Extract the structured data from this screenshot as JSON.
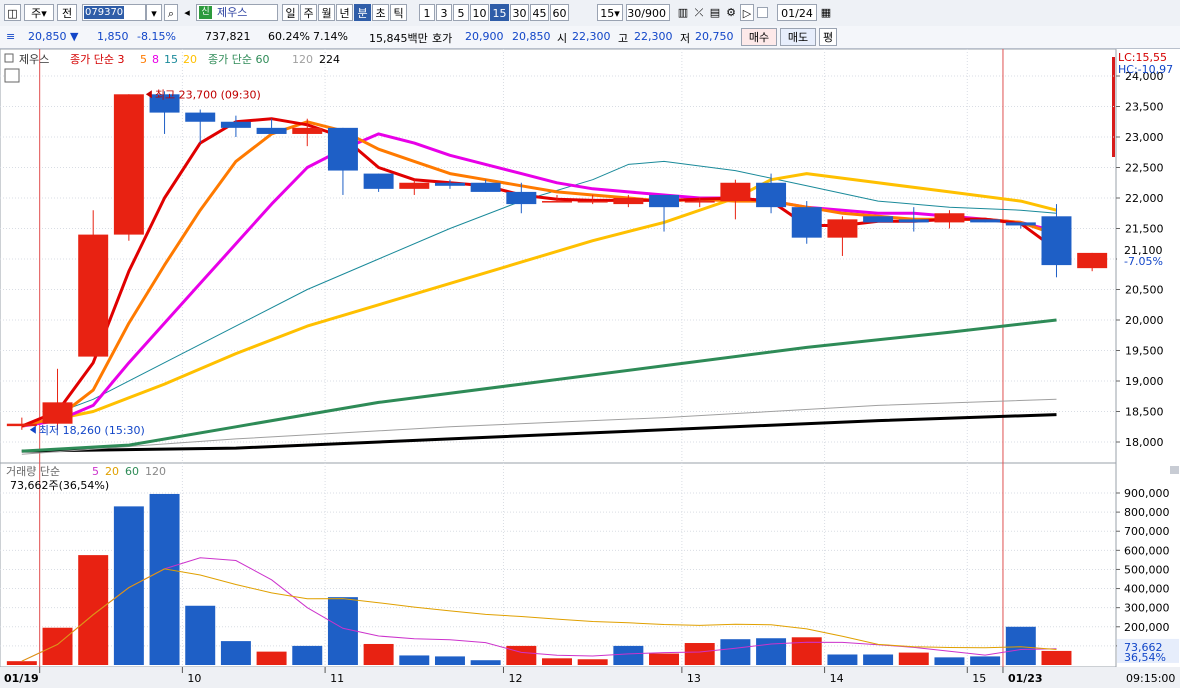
{
  "toolbar": {
    "btn_stock": "주",
    "btn_prev": "전",
    "stock_code": "079370",
    "stock_name": "제우스",
    "badge": "신",
    "periods": [
      "일",
      "주",
      "월",
      "년",
      "분",
      "초",
      "틱"
    ],
    "active_period": "분",
    "intervals": [
      "1",
      "3",
      "5",
      "10",
      "15",
      "30",
      "45",
      "60"
    ],
    "active_interval": "15",
    "interval_select": "15",
    "count": "30/900",
    "date": "01/24"
  },
  "quote": {
    "price": "20,850",
    "change": "1,850",
    "change_pct": "-8.15%",
    "volume": "737,821",
    "volume_ratio": "60.24%",
    "turnover_pct": "7.14%",
    "amount": "15,845백만",
    "ask_label": "호가",
    "ask": "20,900",
    "bid": "20,850",
    "open_label": "시",
    "open": "22,300",
    "high_label": "고",
    "high": "22,300",
    "low_label": "저",
    "low": "20,750",
    "buy_button": "매수",
    "sell_button": "매도",
    "eval_button": "평"
  },
  "price_panel": {
    "legend_name": "제우스",
    "legend_ma_a": "종가 단순 3",
    "legend_ma_a_periods": [
      "5",
      "8",
      "15",
      "20"
    ],
    "legend_ma_b": "종가 단순 60",
    "legend_ma_b_periods": [
      "120",
      "224"
    ],
    "lc": "LC:15,55",
    "hc": "HC:-10,97",
    "high_note": "최고 23,700 (09:30)",
    "low_note": "최저 18,260 (15:30)",
    "last_price": "21,100",
    "last_pct": "-7.05%",
    "colors": {
      "up": "#e82212",
      "down": "#1e5fc6",
      "ma3": "#e00000",
      "ma5": "#ff7a00",
      "ma8": "#e800e8",
      "ma15": "#1a8a9a",
      "ma20": "#ffc000",
      "ma60": "#2e8b57",
      "ma120": "#a0a0a0",
      "ma224": "#000000"
    }
  },
  "volume_panel": {
    "legend": "거래량 단순",
    "legend_periods": [
      "5",
      "20",
      "60",
      "120"
    ],
    "current": "73,662주(36,54%)",
    "last_value": "73,662",
    "last_pct": "36,54%"
  },
  "x_axis": {
    "labels": [
      "01/19",
      "10",
      "11",
      "12",
      "13",
      "14",
      "15",
      "01/23"
    ],
    "time": "09:15:00"
  },
  "chart_data": {
    "type": "candlestick",
    "price_axis_ticks": [
      18000,
      18500,
      19000,
      19500,
      20000,
      20500,
      21000,
      21500,
      22000,
      22500,
      23000,
      23500,
      24000
    ],
    "volume_axis_ticks": [
      100000,
      200000,
      300000,
      400000,
      500000,
      600000,
      700000,
      800000,
      900000
    ],
    "candles": [
      {
        "o": 18260,
        "h": 18400,
        "l": 18200,
        "c": 18300
      },
      {
        "o": 18300,
        "h": 19200,
        "l": 18200,
        "c": 18650
      },
      {
        "o": 19400,
        "h": 21800,
        "l": 19400,
        "c": 21400
      },
      {
        "o": 21400,
        "h": 23700,
        "l": 21300,
        "c": 23700
      },
      {
        "o": 23700,
        "h": 23750,
        "l": 23050,
        "c": 23400
      },
      {
        "o": 23400,
        "h": 23450,
        "l": 22900,
        "c": 23250
      },
      {
        "o": 23250,
        "h": 23350,
        "l": 23000,
        "c": 23150
      },
      {
        "o": 23150,
        "h": 23300,
        "l": 23050,
        "c": 23050
      },
      {
        "o": 23050,
        "h": 23300,
        "l": 22850,
        "c": 23150
      },
      {
        "o": 23150,
        "h": 23150,
        "l": 22050,
        "c": 22450
      },
      {
        "o": 22400,
        "h": 22400,
        "l": 22100,
        "c": 22150
      },
      {
        "o": 22150,
        "h": 22300,
        "l": 22050,
        "c": 22250
      },
      {
        "o": 22250,
        "h": 22300,
        "l": 22150,
        "c": 22200
      },
      {
        "o": 22250,
        "h": 22300,
        "l": 22100,
        "c": 22100
      },
      {
        "o": 22100,
        "h": 22250,
        "l": 21750,
        "c": 21900
      },
      {
        "o": 21950,
        "h": 22050,
        "l": 21950,
        "c": 21950
      },
      {
        "o": 21950,
        "h": 22050,
        "l": 21900,
        "c": 21950
      },
      {
        "o": 21900,
        "h": 22050,
        "l": 21850,
        "c": 22000
      },
      {
        "o": 22050,
        "h": 22050,
        "l": 21450,
        "c": 21850
      },
      {
        "o": 21950,
        "h": 22000,
        "l": 21850,
        "c": 21950
      },
      {
        "o": 21950,
        "h": 22300,
        "l": 21650,
        "c": 22250
      },
      {
        "o": 22250,
        "h": 22400,
        "l": 21750,
        "c": 21850
      },
      {
        "o": 21850,
        "h": 21950,
        "l": 21250,
        "c": 21350
      },
      {
        "o": 21350,
        "h": 21700,
        "l": 21050,
        "c": 21650
      },
      {
        "o": 21700,
        "h": 21700,
        "l": 21600,
        "c": 21600
      },
      {
        "o": 21650,
        "h": 21850,
        "l": 21450,
        "c": 21600
      },
      {
        "o": 21600,
        "h": 21800,
        "l": 21500,
        "c": 21750
      },
      {
        "o": 21650,
        "h": 21650,
        "l": 21600,
        "c": 21600
      },
      {
        "o": 21600,
        "h": 21600,
        "l": 21500,
        "c": 21550
      },
      {
        "o": 21700,
        "h": 21900,
        "l": 20700,
        "c": 20900
      },
      {
        "o": 20850,
        "h": 21100,
        "l": 20800,
        "c": 21100
      }
    ],
    "volumes": [
      20000,
      195000,
      575000,
      830000,
      895000,
      310000,
      125000,
      70000,
      100000,
      355000,
      110000,
      50000,
      45000,
      25000,
      100000,
      35000,
      30000,
      100000,
      60000,
      115000,
      135000,
      140000,
      145000,
      55000,
      55000,
      65000,
      40000,
      45000,
      200000,
      73662
    ],
    "ma_series": {
      "ma3": [
        [
          0,
          18260
        ],
        [
          1,
          18500
        ],
        [
          2,
          19300
        ],
        [
          3,
          20800
        ],
        [
          4,
          22000
        ],
        [
          5,
          22900
        ],
        [
          6,
          23250
        ],
        [
          7,
          23300
        ],
        [
          8,
          23200
        ],
        [
          9,
          23000
        ],
        [
          10,
          22500
        ],
        [
          11,
          22300
        ],
        [
          12,
          22250
        ],
        [
          13,
          22200
        ],
        [
          14,
          22050
        ],
        [
          15,
          21980
        ],
        [
          16,
          21960
        ],
        [
          17,
          21960
        ],
        [
          18,
          21960
        ],
        [
          19,
          21980
        ],
        [
          20,
          22000
        ],
        [
          21,
          21950
        ],
        [
          22,
          21550
        ],
        [
          23,
          21550
        ],
        [
          24,
          21620
        ],
        [
          25,
          21620
        ],
        [
          26,
          21650
        ],
        [
          27,
          21650
        ],
        [
          28,
          21580
        ],
        [
          29,
          21150
        ]
      ],
      "ma5": [
        [
          0,
          18260
        ],
        [
          1,
          18400
        ],
        [
          2,
          18850
        ],
        [
          3,
          19950
        ],
        [
          4,
          20900
        ],
        [
          5,
          21800
        ],
        [
          6,
          22600
        ],
        [
          7,
          23050
        ],
        [
          8,
          23250
        ],
        [
          9,
          23100
        ],
        [
          10,
          22800
        ],
        [
          11,
          22600
        ],
        [
          12,
          22400
        ],
        [
          13,
          22300
        ],
        [
          14,
          22200
        ],
        [
          15,
          22100
        ],
        [
          16,
          22050
        ],
        [
          17,
          22000
        ],
        [
          18,
          21950
        ],
        [
          19,
          21980
        ],
        [
          20,
          21950
        ],
        [
          21,
          21950
        ],
        [
          22,
          21850
        ],
        [
          23,
          21750
        ],
        [
          24,
          21700
        ],
        [
          25,
          21650
        ],
        [
          26,
          21650
        ],
        [
          27,
          21650
        ],
        [
          28,
          21600
        ],
        [
          29,
          21400
        ]
      ],
      "ma8": [
        [
          0,
          18260
        ],
        [
          1,
          18350
        ],
        [
          2,
          18600
        ],
        [
          3,
          19300
        ],
        [
          4,
          19950
        ],
        [
          5,
          20600
        ],
        [
          6,
          21250
        ],
        [
          7,
          21900
        ],
        [
          8,
          22500
        ],
        [
          9,
          22800
        ],
        [
          10,
          23050
        ],
        [
          11,
          22900
        ],
        [
          12,
          22700
        ],
        [
          13,
          22550
        ],
        [
          14,
          22400
        ],
        [
          15,
          22250
        ],
        [
          16,
          22150
        ],
        [
          17,
          22100
        ],
        [
          18,
          22050
        ],
        [
          19,
          22000
        ],
        [
          20,
          22000
        ],
        [
          21,
          21950
        ],
        [
          22,
          21850
        ],
        [
          23,
          21800
        ],
        [
          24,
          21750
        ],
        [
          25,
          21750
        ],
        [
          26,
          21700
        ],
        [
          27,
          21650
        ],
        [
          28,
          21600
        ],
        [
          29,
          21450
        ]
      ],
      "ma15": [
        [
          0,
          18260
        ],
        [
          2,
          18700
        ],
        [
          4,
          19300
        ],
        [
          6,
          19900
        ],
        [
          8,
          20500
        ],
        [
          10,
          21000
        ],
        [
          12,
          21500
        ],
        [
          14,
          21950
        ],
        [
          16,
          22300
        ],
        [
          17,
          22550
        ],
        [
          18,
          22600
        ],
        [
          20,
          22450
        ],
        [
          22,
          22200
        ],
        [
          24,
          21950
        ],
        [
          26,
          21850
        ],
        [
          28,
          21800
        ],
        [
          29,
          21750
        ]
      ],
      "ma20": [
        [
          0,
          18260
        ],
        [
          2,
          18500
        ],
        [
          4,
          18950
        ],
        [
          6,
          19450
        ],
        [
          8,
          19900
        ],
        [
          10,
          20250
        ],
        [
          12,
          20600
        ],
        [
          14,
          20950
        ],
        [
          16,
          21300
        ],
        [
          18,
          21600
        ],
        [
          20,
          22000
        ],
        [
          21,
          22300
        ],
        [
          22,
          22400
        ],
        [
          24,
          22250
        ],
        [
          26,
          22100
        ],
        [
          28,
          21950
        ],
        [
          29,
          21800
        ]
      ],
      "ma60": [
        [
          0,
          17850
        ],
        [
          3,
          17950
        ],
        [
          6,
          18250
        ],
        [
          10,
          18650
        ],
        [
          14,
          18950
        ],
        [
          18,
          19250
        ],
        [
          22,
          19550
        ],
        [
          26,
          19800
        ],
        [
          29,
          20000
        ]
      ],
      "ma120": [
        [
          0,
          17800
        ],
        [
          6,
          18050
        ],
        [
          12,
          18250
        ],
        [
          18,
          18400
        ],
        [
          24,
          18600
        ],
        [
          29,
          18700
        ]
      ],
      "ma224": [
        [
          0,
          17850
        ],
        [
          6,
          17900
        ],
        [
          12,
          18050
        ],
        [
          18,
          18200
        ],
        [
          24,
          18350
        ],
        [
          29,
          18450
        ]
      ]
    }
  }
}
